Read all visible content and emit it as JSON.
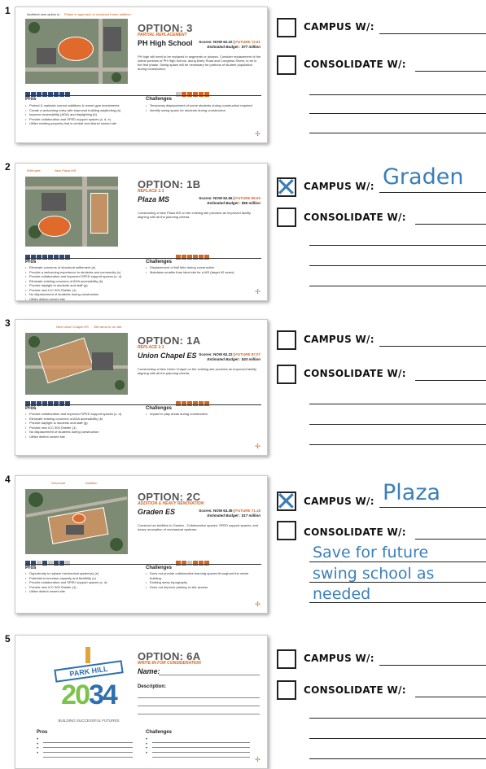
{
  "rows": [
    {
      "num": "1",
      "option": "OPTION: 3",
      "subtitle": "PARTIAL REPLACEMENT",
      "school": "PH High School",
      "scores": "Scores: NOW 62.22 |",
      "future": "FUTURE 72.81",
      "budget": "Estimated Budget : $77 million",
      "description": "PH high will need to be replaced in segments or phases. Consider replacement of the oldest portions of PH High School, along Barry Road and Congress Street, to be in the first phase. Swing space will be necessary for portions of student population during construction.",
      "map_labels": [
        "Architect new option to",
        "Phase in approach to construct future addition"
      ],
      "site_label": "New Addition",
      "pros_title": "Pros",
      "pros": [
        "Protect & maintain current additions & recent gym investments",
        "Create a welcoming entry with improved building wayfinding (a)",
        "Improve accessibility (ADA) and daylighting (b)",
        "Provide collaboration and SPED support spaces (c, d, e)",
        "Utilize existing property that is central and district owned site"
      ],
      "cons_title": "Challenges",
      "cons": [
        "Temporary displacement of some students during construction required",
        "Identify swing space for students during construction"
      ],
      "campus_checked": false,
      "campus_text": "",
      "consolidate_text": "",
      "notes": []
    },
    {
      "num": "2",
      "option": "OPTION: 1B",
      "subtitle": "REPLACE 1:1",
      "school": "Plaza MS",
      "scores": "Scores: NOW 62.66 |",
      "future": "FUTURE 86.93",
      "budget": "Estimated Budget : $56 million",
      "description": "Constructing a New Plaza MS on the existing site provides an improved facility aligning with all the planning criteria.",
      "map_labels": [
        "With safe",
        "New Plaza MS",
        "Ball field location"
      ],
      "site_label": "New Plaza MS",
      "pros_title": "Pros",
      "pros": [
        "Eliminate concerns of structural settlement (e)",
        "Provide a welcoming experience to students and community (c)",
        "Provide collaboration and improved SPED support spaces (c, d)",
        "Eliminate existing concerns of ADA accessibility (b)",
        "Provide daylight to students and staff (g)",
        "Provide new ICC 500 Shelter (1)",
        "No displacement of students during construction",
        "Utilize district owned site"
      ],
      "cons_title": "Challenges",
      "cons": [
        "Displacement of ball field during construction",
        "Maintains smaller than ideal site for a MS (target 40 acres)"
      ],
      "campus_checked": true,
      "campus_text": "Graden",
      "consolidate_text": "",
      "notes": []
    },
    {
      "num": "3",
      "option": "OPTION: 1A",
      "subtitle": "REPLACE 1:1",
      "school": "Union Chapel ES",
      "scores": "Scores: NOW 62.22 |",
      "future": "FUTURE 87.07",
      "budget": "Estimated Budget : $43 million",
      "description": "Constructing a New Union Chapel on the existing site provides an improved facility aligning with all the planning criteria.",
      "map_labels": [
        "New Union Chapel ES",
        "Site area for on site"
      ],
      "site_label": "Existing",
      "pros_title": "Pros",
      "pros": [
        "Provide collaboration and improved SPED support spaces (c, d)",
        "Eliminate existing concerns of ADA accessibility (b)",
        "Provide daylight to students and staff (g)",
        "Provide new ICC 500 Shelter (1)",
        "No displacement of students during construction",
        "Utilize district owned site"
      ],
      "cons_title": "Challenges",
      "cons": [
        "Impact to play areas during construction"
      ],
      "campus_checked": false,
      "campus_text": "",
      "consolidate_text": "",
      "notes": []
    },
    {
      "num": "4",
      "option": "OPTION: 2C",
      "subtitle": "ADDITION & HEAVY RENOVATION",
      "school": "Graden ES",
      "scores": "Scores: NOW 63.36 |",
      "future": "FUTURE 71.18",
      "budget": "Estimated Budget : $17 million",
      "description": "Construct an Addition to Graden - Collaboration spaces, SPED support spaces, and heavy renovation of mechanical systems.",
      "map_labels": [
        "Structural",
        "Addition"
      ],
      "site_label": "Addition",
      "pros_title": "Pros",
      "pros": [
        "Opportunity to replace mechanical system(s) (e)",
        "Potential to increase capacity and flexibility (c)",
        "Provide collaboration and SPED support spaces (c, d)",
        "Provide new ICC 500 Shelter (1)",
        "Utilize district owned site"
      ],
      "cons_title": "Challenges",
      "cons": [
        "Does not provide collaborative learning spaces throughout the whole building",
        "Existing steep topography",
        "Does not improve parking or site access"
      ],
      "campus_checked": true,
      "campus_text": "Plaza",
      "consolidate_text": "Save for future",
      "notes": [
        "swing school as",
        "needed"
      ]
    },
    {
      "num": "5",
      "option": "OPTION: 6A",
      "subtitle": "WRITE-IN FOR CONSIDERATION",
      "school": "Name:",
      "description_label": "Description:",
      "logo_top": "PARK HILL",
      "logo_year_a": "20",
      "logo_year_b": "34",
      "logo_tagline": "BUILDING SUCCESSFUL FUTURES",
      "pros_title": "Pros",
      "cons_title": "Challenges",
      "campus_checked": false,
      "campus_text": "",
      "consolidate_text": "",
      "notes": []
    }
  ],
  "campus_label": "CAMPUS W/:",
  "consolidate_label": "CONSOLIDATE W/:",
  "colors": {
    "accent": "#d4661f",
    "navy": "#2f4a7a",
    "ink": "#3a7fb9"
  }
}
